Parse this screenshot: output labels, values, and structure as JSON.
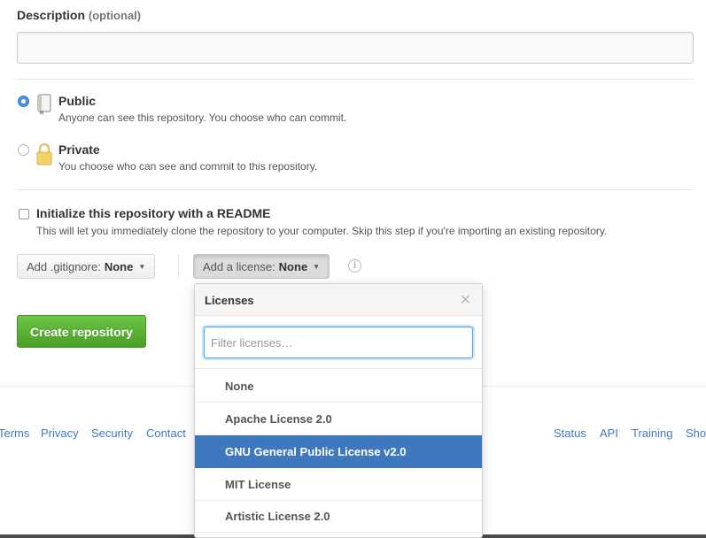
{
  "description": {
    "label": "Description",
    "optional": "(optional)",
    "value": ""
  },
  "visibility": {
    "public": {
      "title": "Public",
      "note": "Anyone can see this repository. You choose who can commit.",
      "checked": true
    },
    "private": {
      "title": "Private",
      "note": "You choose who can see and commit to this repository.",
      "checked": false
    }
  },
  "readme": {
    "title": "Initialize this repository with a README",
    "note": "This will let you immediately clone the repository to your computer. Skip this step if you're importing an existing repository.",
    "checked": false
  },
  "gitignore": {
    "label": "Add .gitignore:",
    "value": "None"
  },
  "license": {
    "label": "Add a license:",
    "value": "None"
  },
  "create_button": "Create repository",
  "license_dropdown": {
    "title": "Licenses",
    "filter_placeholder": "Filter licenses…",
    "items": [
      {
        "label": "None",
        "selected": false
      },
      {
        "label": "Apache License 2.0",
        "selected": false
      },
      {
        "label": "GNU General Public License v2.0",
        "selected": true
      },
      {
        "label": "MIT License",
        "selected": false
      },
      {
        "label": "Artistic License 2.0",
        "selected": false
      }
    ]
  },
  "footer": {
    "left": [
      "Terms",
      "Privacy",
      "Security",
      "Contact"
    ],
    "right": [
      "Status",
      "API",
      "Training",
      "Sho"
    ]
  },
  "colors": {
    "accent_blue": "#4078c0",
    "create_green": "#55a532",
    "radio_blue": "#4a90e2"
  }
}
